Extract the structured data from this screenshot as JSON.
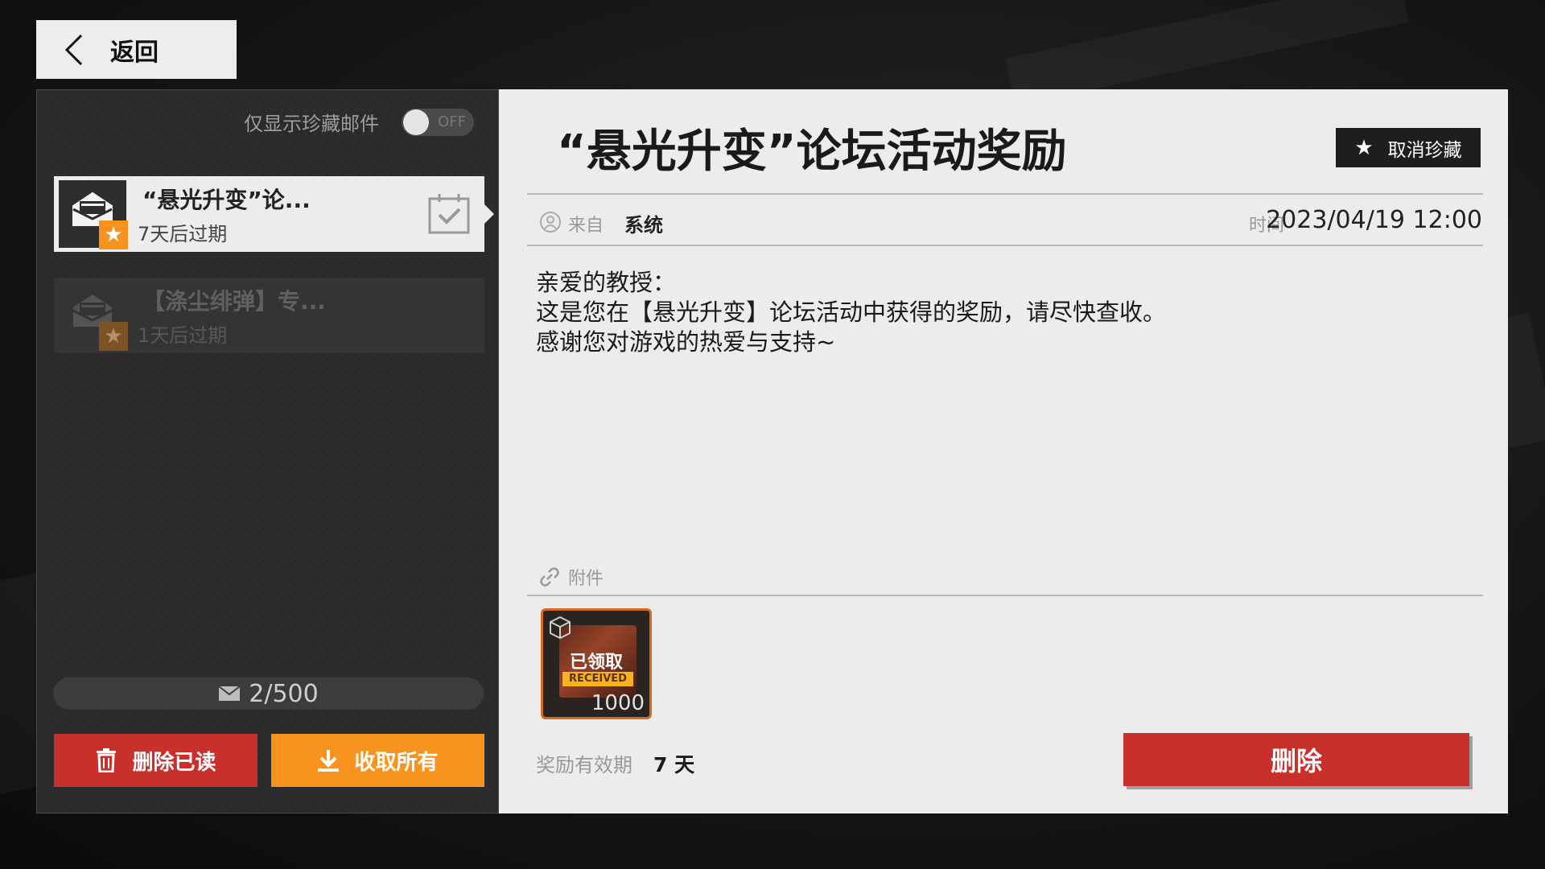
{
  "nav": {
    "back_label": "返回"
  },
  "filter": {
    "label": "仅显示珍藏邮件",
    "toggle_state": "OFF"
  },
  "mail_list": [
    {
      "title": "“悬光升变”论...",
      "expiry": "7天后过期",
      "selected": true
    },
    {
      "title": "【涤尘绯弹】专...",
      "expiry": "1天后过期",
      "selected": false
    }
  ],
  "counter": {
    "text": "2/500"
  },
  "actions": {
    "delete_read": "删除已读",
    "claim_all": "收取所有"
  },
  "mail": {
    "title": "“悬光升变”论坛活动奖励",
    "unfavorite_label": "取消珍藏",
    "from_label": "来自",
    "from_value": "系统",
    "time_label": "时间",
    "time_value": "2023/04/19 12:00",
    "body": [
      "亲爱的教授：",
      "这是您在【悬光升变】论坛活动中获得的奖励，请尽快查收。",
      "感谢您对游戏的热爱与支持~"
    ],
    "attachment_label": "附件",
    "attachment": {
      "status_cn": "已领取",
      "status_en": "RECEIVED",
      "quantity": "1000"
    },
    "validity_label": "奖励有效期",
    "validity_value": "7 天",
    "delete_label": "删除"
  },
  "colors": {
    "accent_orange": "#f7931e",
    "danger_red": "#c9302c",
    "panel_light": "#ececec",
    "panel_dark": "#2b2b2b"
  }
}
